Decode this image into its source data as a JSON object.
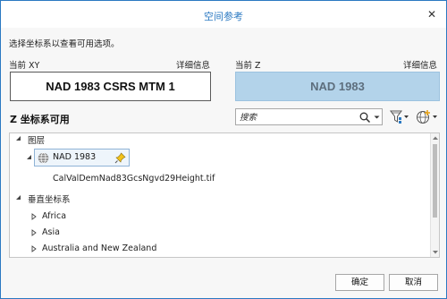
{
  "dialog": {
    "title": "空间参考",
    "close_glyph": "✕"
  },
  "instructions": "选择坐标系以查看可用选项。",
  "current_xy": {
    "label": "当前 XY",
    "details_link": "详细信息",
    "value": "NAD 1983 CSRS MTM  1"
  },
  "current_z": {
    "label": "当前 Z",
    "details_link": "详细信息",
    "value": "NAD 1983"
  },
  "z_section": {
    "title": "Z 坐标系可用"
  },
  "search": {
    "placeholder": "搜索",
    "icon": "search-icon"
  },
  "toolbar": {
    "filter_icon": "filter-icon",
    "globe_add_icon": "globe-add-icon"
  },
  "tree": {
    "layers_label": "图层",
    "selected_item": "NAD 1983",
    "layer_file": "CalValDemNad83GcsNgvd29Height.tif",
    "vertical_label": "垂直坐标系",
    "regions": [
      "Africa",
      "Asia",
      "Australia and New Zealand"
    ]
  },
  "buttons": {
    "ok": "确定",
    "cancel": "取消"
  },
  "colors": {
    "accent": "#2b79c2",
    "z_box_fill": "#b3d3ea"
  }
}
